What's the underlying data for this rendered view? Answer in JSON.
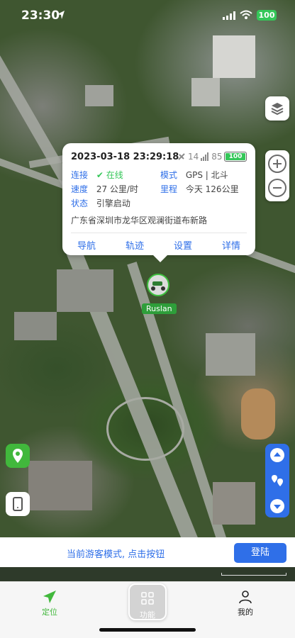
{
  "status_bar": {
    "time": "23:30",
    "battery": "100"
  },
  "popup": {
    "datetime": "2023-03-18 23:29:18",
    "satellites": "14",
    "signal": "85",
    "battery": "100",
    "battery_level_pct": 100,
    "rows": [
      {
        "label": "连接",
        "value": "在线",
        "label2": "模式",
        "value2": "GPS | 北斗"
      },
      {
        "label": "速度",
        "value": "27 公里/时",
        "label2": "里程",
        "value2": "今天 126公里"
      },
      {
        "label": "状态",
        "value": "引擎启动"
      }
    ],
    "address": "广东省深圳市龙华区观澜街道布新路",
    "actions": [
      "导航",
      "轨迹",
      "设置",
      "详情"
    ]
  },
  "marker": {
    "name": "Ruslan"
  },
  "banner": {
    "message": "当前游客模式, 点击按钮",
    "login": "登陆"
  },
  "tabs": [
    {
      "label": "定位",
      "icon": "send-icon",
      "active_color": "#41b83c"
    },
    {
      "label": "功能",
      "icon": "grid-icon"
    },
    {
      "label": "我的",
      "icon": "person-icon"
    }
  ],
  "colors": {
    "accent": "#2f6fe8",
    "online": "#35c759",
    "marker": "#2e9e3a"
  }
}
